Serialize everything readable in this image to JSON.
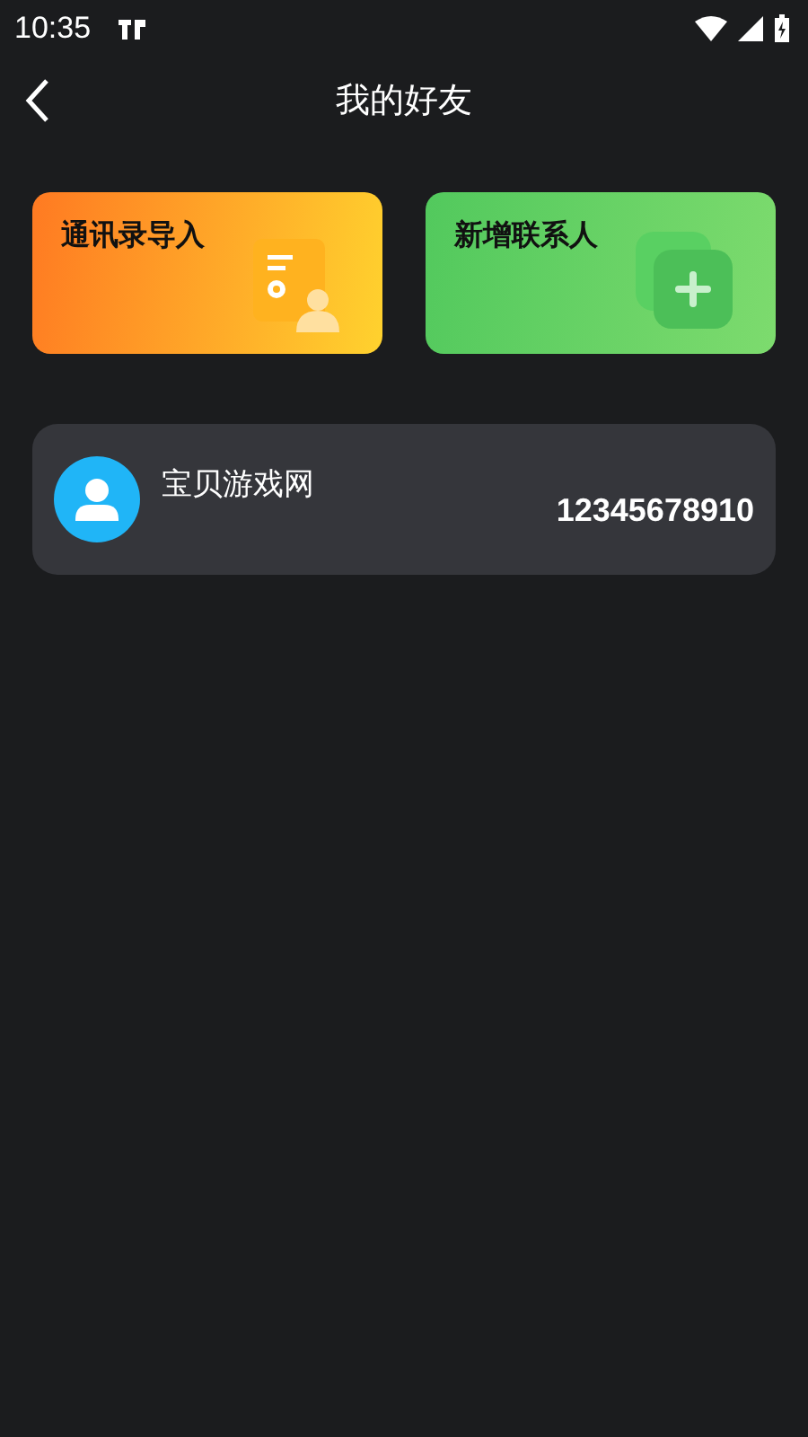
{
  "status_bar": {
    "time": "10:35"
  },
  "header": {
    "title": "我的好友"
  },
  "actions": [
    {
      "kind": "import",
      "label": "通讯录导入"
    },
    {
      "kind": "add",
      "label": "新增联系人"
    }
  ],
  "contacts": [
    {
      "name": "宝贝游戏网",
      "phone": "12345678910"
    }
  ]
}
